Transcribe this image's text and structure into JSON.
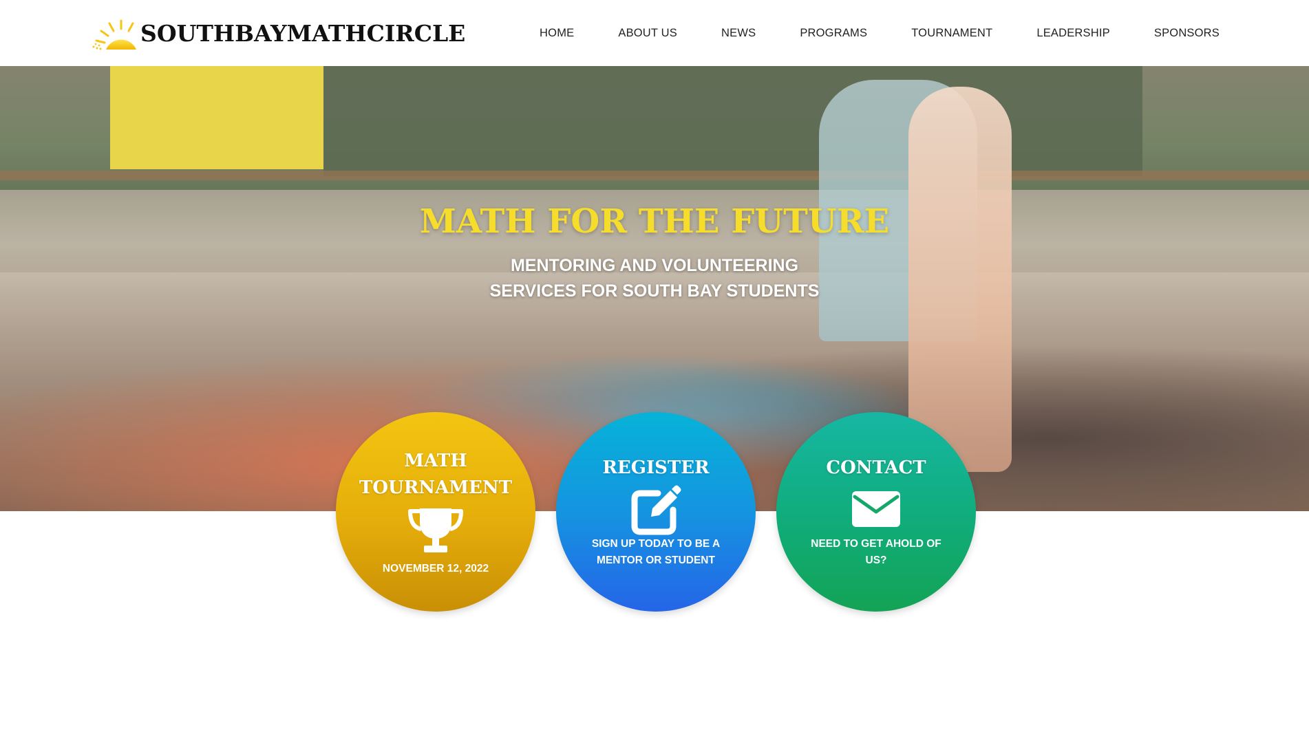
{
  "header": {
    "logo_text": "SOUTHBAYMATHCIRCLE",
    "logo_icon": "sun-rising-icon",
    "nav": [
      {
        "label": "HOME"
      },
      {
        "label": "ABOUT US"
      },
      {
        "label": "NEWS"
      },
      {
        "label": "PROGRAMS"
      },
      {
        "label": "TOURNAMENT"
      },
      {
        "label": "LEADERSHIP"
      },
      {
        "label": "SPONSORS"
      }
    ]
  },
  "hero": {
    "title": "MATH FOR THE FUTURE",
    "subtitle_line1": "MENTORING AND VOLUNTEERING",
    "subtitle_line2": "SERVICES FOR SOUTH BAY STUDENTS",
    "image": "classroom-raised-hands-photo"
  },
  "cards": {
    "tournament": {
      "title_line1": "MATH",
      "title_line2": "TOURNAMENT",
      "icon": "trophy-icon",
      "caption": "NOVEMBER 12, 2022",
      "color": "#e9b00b"
    },
    "register": {
      "title": "REGISTER",
      "icon": "edit-pencil-icon",
      "caption_line1": "SIGN UP TODAY TO BE A",
      "caption_line2": "MENTOR OR STUDENT",
      "color": "#1a86e3"
    },
    "contact": {
      "title": "CONTACT",
      "icon": "envelope-icon",
      "caption_line1": "NEED TO GET AHOLD OF",
      "caption_line2": "US?",
      "color": "#12ad74"
    }
  },
  "colors": {
    "title_yellow": "#f7dd2b",
    "header_bg": "#ffffff"
  }
}
